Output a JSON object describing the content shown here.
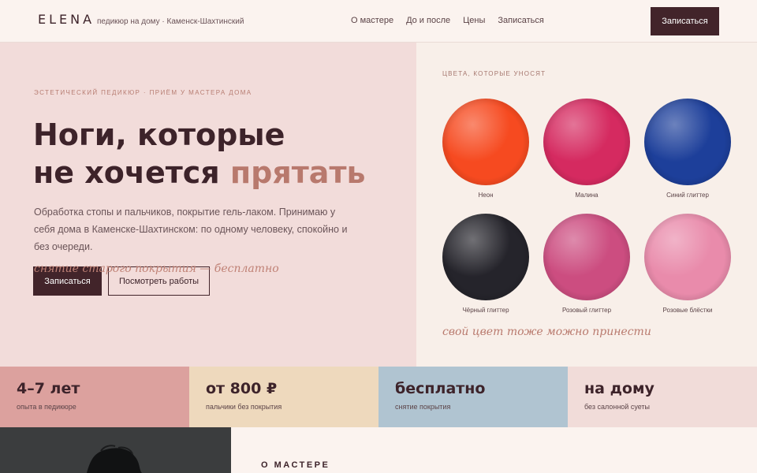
{
  "header": {
    "logo": "ELENA",
    "tagline": "педикюр на дому · Каменск-Шахтинский",
    "nav": [
      "О мастере",
      "До и после",
      "Цены",
      "Записаться"
    ],
    "cta": "Записаться"
  },
  "hero": {
    "eyebrow": "ЭСТЕТИЧЕСКИЙ ПЕДИКЮР · ПРИЁМ У МАСТЕРА ДОМА",
    "title_line1": "Ноги, которые",
    "title_line2_pre": "не хочется ",
    "title_line2_accent": "прятать",
    "lead": "Обработка стопы и пальчиков, покрытие гель-лаком. Принимаю у себя дома в Каменске-Шахтинском: по одному человеку, спокойно и без очереди.",
    "btn_primary": "Записаться",
    "btn_secondary": "Посмотреть работы",
    "note": "снятие старого покрытия — бесплатно"
  },
  "colors": {
    "title": "ЦВЕТА, КОТОРЫЕ УНОСЯТ",
    "items": [
      {
        "label": "Неон",
        "color": "#f64a20"
      },
      {
        "label": "Малина",
        "color": "#d52a60"
      },
      {
        "label": "Синий глиттер",
        "color": "#1d3f9a"
      },
      {
        "label": "Чёрный глиттер",
        "color": "#25242b"
      },
      {
        "label": "Розовый глиттер",
        "color": "#cc4d80"
      },
      {
        "label": "Розовые блёстки",
        "color": "#e98bab"
      }
    ],
    "note": "свой цвет тоже можно принести"
  },
  "stats": [
    {
      "value": "4–7 лет",
      "caption": "опыта в педикюре",
      "bg": "#dca19e"
    },
    {
      "value": "от 800 ₽",
      "caption": "пальчики без покрытия",
      "bg": "#eed9bd"
    },
    {
      "value": "бесплатно",
      "caption": "снятие покрытия",
      "bg": "#b0c4d1"
    },
    {
      "value": "на дому",
      "caption": "без салонной суеты",
      "bg": "#f1dcd9"
    }
  ],
  "about": {
    "title": "О МАСТЕРЕ"
  }
}
